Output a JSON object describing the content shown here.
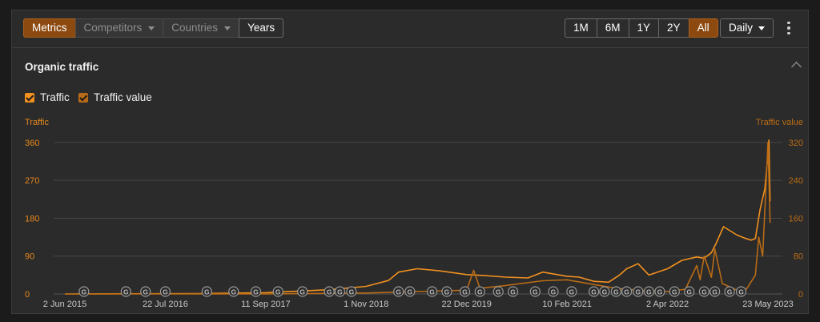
{
  "toolbar": {
    "view_tabs": [
      {
        "label": "Metrics",
        "active": true
      },
      {
        "label": "Competitors",
        "dropdown": true
      },
      {
        "label": "Countries",
        "dropdown": true
      },
      {
        "label": "Years"
      }
    ],
    "ranges": [
      {
        "label": "1M"
      },
      {
        "label": "6M"
      },
      {
        "label": "1Y"
      },
      {
        "label": "2Y"
      },
      {
        "label": "All",
        "active": true
      }
    ],
    "granularity": "Daily",
    "more_icon": "vertical-ellipsis-icon",
    "colors": {
      "accent": "#8d4a10"
    }
  },
  "section": {
    "title": "Organic traffic",
    "collapse_icon": "chevron-up-icon"
  },
  "legend": [
    {
      "label": "Traffic",
      "checked": true,
      "color": "#f0901e"
    },
    {
      "label": "Traffic value",
      "checked": true,
      "color": "#b86b16"
    }
  ],
  "chart_data": {
    "type": "line",
    "left_axis_label": "Traffic",
    "right_axis_label": "Traffic value",
    "left_ticks": [
      0,
      90,
      180,
      270,
      360
    ],
    "right_ticks": [
      0,
      80,
      160,
      240,
      320
    ],
    "x_ticks": [
      "2 Jun 2015",
      "22 Jul 2016",
      "11 Sep 2017",
      "1 Nov 2018",
      "22 Dec 2019",
      "10 Feb 2021",
      "2 Apr 2022",
      "23 May 2023"
    ],
    "ylim_left": [
      0,
      396
    ],
    "ylim_right": [
      0,
      352
    ],
    "grid": true,
    "marker_icon": "google-update-icon",
    "series": [
      {
        "name": "Traffic",
        "axis": "left",
        "color": "#f0901e",
        "x": [
          "2015-06-02",
          "2016-12-01",
          "2017-09-11",
          "2018-01-01",
          "2018-06-01",
          "2018-11-01",
          "2019-02-01",
          "2019-03-15",
          "2019-06-01",
          "2019-09-01",
          "2019-12-22",
          "2020-03-01",
          "2020-06-01",
          "2020-09-01",
          "2020-11-01",
          "2021-02-10",
          "2021-04-01",
          "2021-06-01",
          "2021-08-01",
          "2021-09-15",
          "2021-10-15",
          "2021-12-01",
          "2022-01-15",
          "2022-04-02",
          "2022-06-01",
          "2022-08-01",
          "2022-09-01",
          "2022-10-01",
          "2022-10-20",
          "2022-11-20",
          "2023-01-15",
          "2023-02-20",
          "2023-03-15",
          "2023-04-01",
          "2023-04-20",
          "2023-05-10",
          "2023-05-23",
          "2023-05-27",
          "2023-06-01"
        ],
        "y": [
          0,
          1,
          3,
          6,
          10,
          18,
          32,
          52,
          60,
          55,
          46,
          44,
          40,
          38,
          52,
          42,
          40,
          30,
          28,
          45,
          60,
          72,
          45,
          60,
          80,
          88,
          85,
          98,
          120,
          160,
          140,
          132,
          128,
          132,
          200,
          250,
          330,
          366,
          220
        ]
      },
      {
        "name": "Traffic value",
        "axis": "right",
        "color": "#b86b16",
        "x": [
          "2015-06-02",
          "2017-09-11",
          "2018-11-01",
          "2019-06-01",
          "2019-12-22",
          "2020-01-20",
          "2020-02-15",
          "2020-06-01",
          "2020-11-01",
          "2021-02-10",
          "2021-06-01",
          "2021-09-01",
          "2021-12-01",
          "2022-04-02",
          "2022-06-15",
          "2022-08-01",
          "2022-08-15",
          "2022-09-01",
          "2022-10-01",
          "2022-10-15",
          "2022-11-15",
          "2023-01-15",
          "2023-02-15",
          "2023-03-01",
          "2023-04-01",
          "2023-04-15",
          "2023-05-01",
          "2023-05-15",
          "2023-05-23",
          "2023-06-01"
        ],
        "y": [
          0,
          0,
          2,
          5,
          8,
          50,
          12,
          18,
          28,
          30,
          20,
          12,
          8,
          5,
          10,
          60,
          30,
          80,
          35,
          95,
          22,
          8,
          5,
          15,
          40,
          120,
          80,
          230,
          320,
          150
        ]
      }
    ],
    "markers": [
      "2015-08-20",
      "2016-02-10",
      "2016-05-01",
      "2016-07-22",
      "2017-01-10",
      "2017-05-01",
      "2017-08-01",
      "2017-11-01",
      "2018-02-10",
      "2018-06-01",
      "2018-07-15",
      "2018-09-01",
      "2019-03-15",
      "2019-05-01",
      "2019-08-01",
      "2019-10-01",
      "2019-12-15",
      "2020-02-15",
      "2020-05-01",
      "2020-07-01",
      "2020-10-01",
      "2020-12-15",
      "2021-03-01",
      "2021-06-01",
      "2021-07-15",
      "2021-09-01",
      "2021-10-15",
      "2021-12-01",
      "2022-01-15",
      "2022-03-01",
      "2022-05-01",
      "2022-07-01",
      "2022-09-01",
      "2022-10-15",
      "2022-12-15",
      "2023-02-01"
    ]
  }
}
